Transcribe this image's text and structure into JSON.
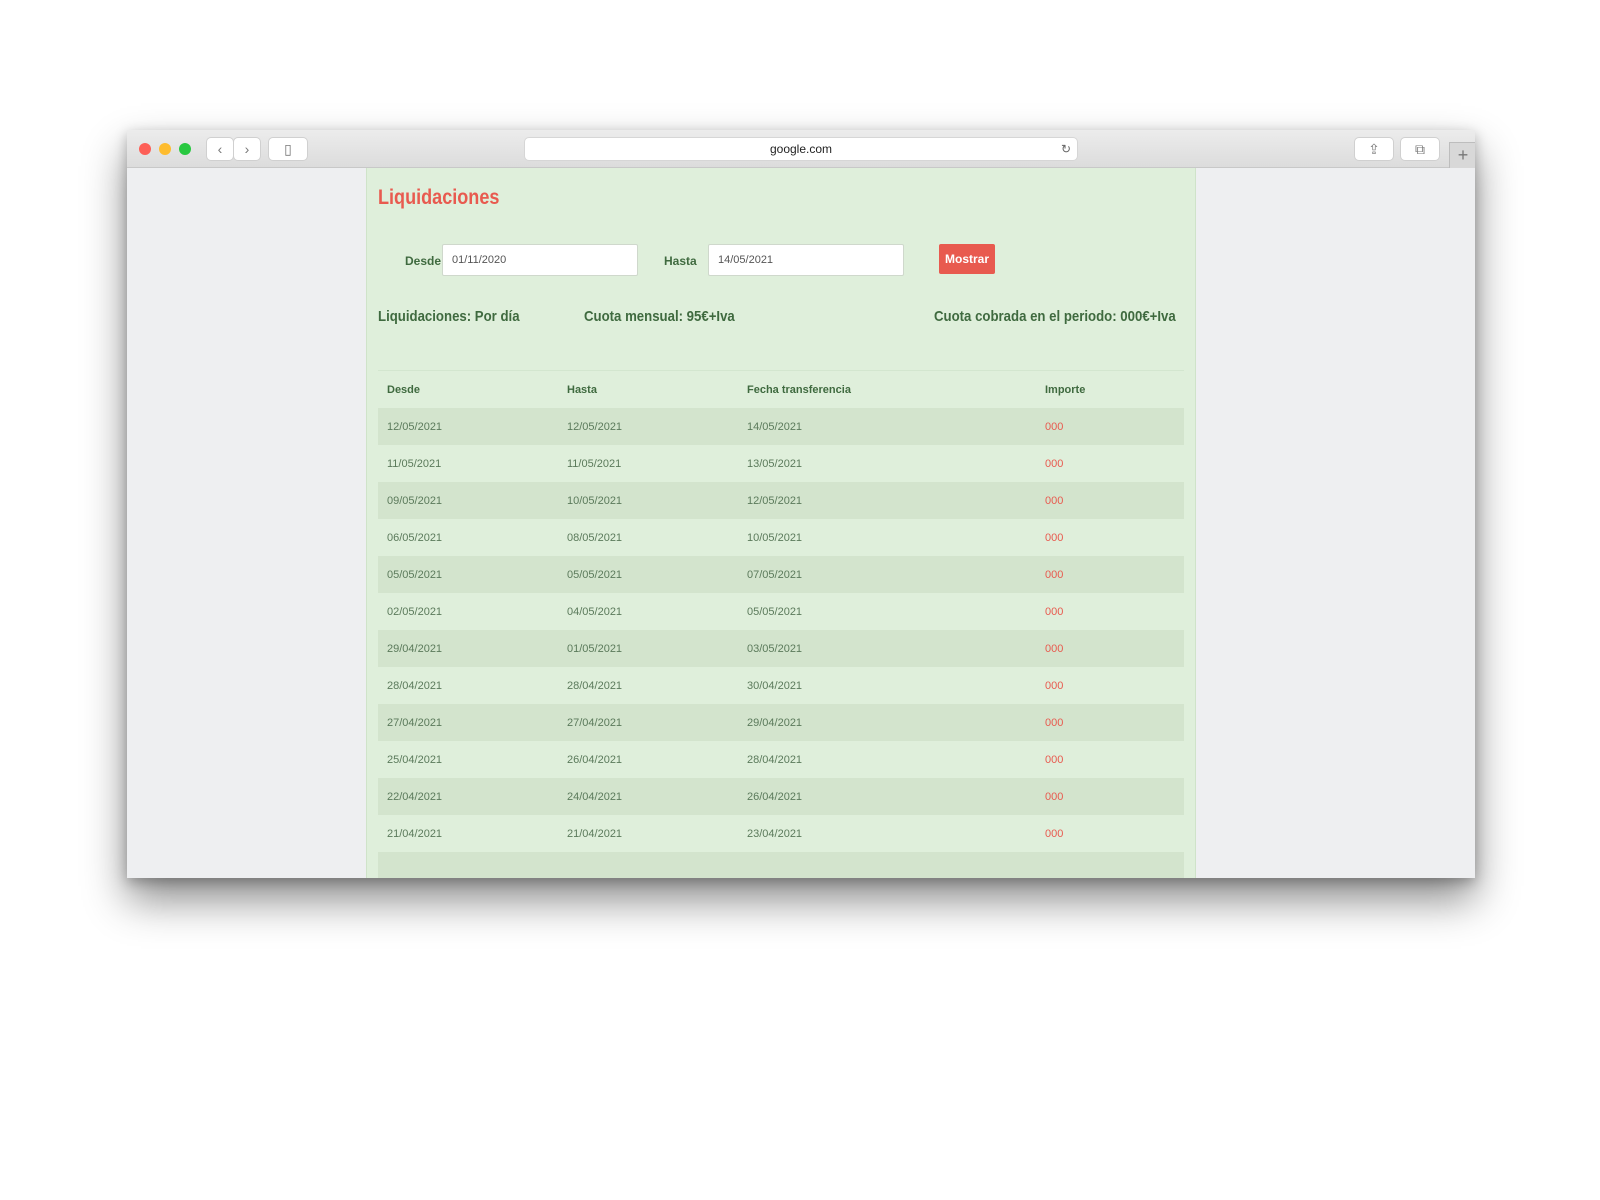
{
  "browser": {
    "address": "google.com",
    "back_icon": "‹",
    "forward_icon": "›",
    "sidebar_icon": "▯",
    "reload_icon": "↻",
    "share_icon": "⇪",
    "tabs_icon": "⧉",
    "new_tab_icon": "+"
  },
  "page": {
    "title": "Liquidaciones"
  },
  "filter": {
    "from_label": "Desde",
    "from_value": "01/11/2020",
    "to_label": "Hasta",
    "to_value": "14/05/2021",
    "show_button": "Mostrar"
  },
  "summary": {
    "settlements": "Liquidaciones: Por día",
    "monthly_fee": "Cuota mensual: 95€+Iva",
    "fee_collected": "Cuota cobrada en el periodo: 000€+Iva"
  },
  "table": {
    "headers": [
      "Desde",
      "Hasta",
      "Fecha transferencia",
      "Importe"
    ],
    "rows": [
      [
        "12/05/2021",
        "12/05/2021",
        "14/05/2021",
        "000"
      ],
      [
        "11/05/2021",
        "11/05/2021",
        "13/05/2021",
        "000"
      ],
      [
        "09/05/2021",
        "10/05/2021",
        "12/05/2021",
        "000"
      ],
      [
        "06/05/2021",
        "08/05/2021",
        "10/05/2021",
        "000"
      ],
      [
        "05/05/2021",
        "05/05/2021",
        "07/05/2021",
        "000"
      ],
      [
        "02/05/2021",
        "04/05/2021",
        "05/05/2021",
        "000"
      ],
      [
        "29/04/2021",
        "01/05/2021",
        "03/05/2021",
        "000"
      ],
      [
        "28/04/2021",
        "28/04/2021",
        "30/04/2021",
        "000"
      ],
      [
        "27/04/2021",
        "27/04/2021",
        "29/04/2021",
        "000"
      ],
      [
        "25/04/2021",
        "26/04/2021",
        "28/04/2021",
        "000"
      ],
      [
        "22/04/2021",
        "24/04/2021",
        "26/04/2021",
        "000"
      ],
      [
        "21/04/2021",
        "21/04/2021",
        "23/04/2021",
        "000"
      ]
    ]
  },
  "colors": {
    "accent": "#e85a4f",
    "page_background": "#dfefdb",
    "text_green": "#3f6a3f"
  }
}
